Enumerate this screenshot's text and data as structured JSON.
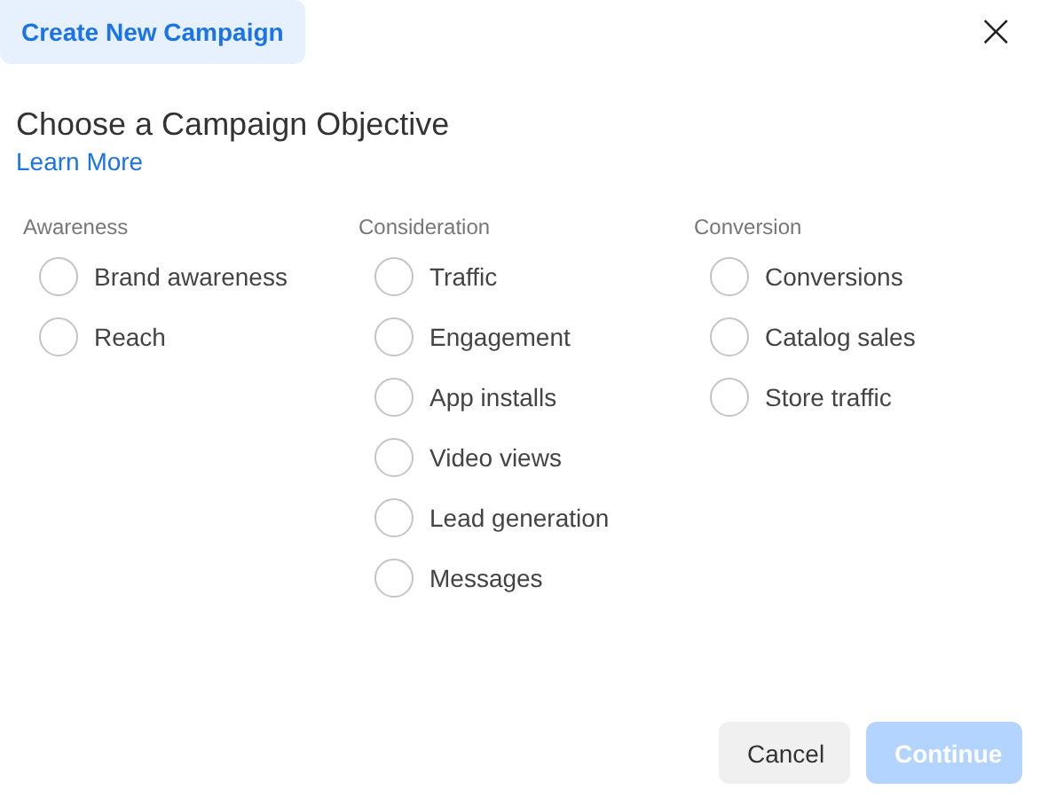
{
  "tab": {
    "label": "Create New Campaign",
    "selected": true
  },
  "close": {
    "label": "×"
  },
  "heading": "Choose a Campaign Objective",
  "learn_more": "Learn More",
  "groups": [
    {
      "label": "Awareness",
      "options": [
        {
          "label": "Brand awareness",
          "selected": false
        },
        {
          "label": "Reach",
          "selected": false
        }
      ]
    },
    {
      "label": "Consideration",
      "options": [
        {
          "label": "Traffic",
          "selected": false
        },
        {
          "label": "Engagement",
          "selected": false
        },
        {
          "label": "App installs",
          "selected": false
        },
        {
          "label": "Video views",
          "selected": false
        },
        {
          "label": "Lead generation",
          "selected": false
        },
        {
          "label": "Messages",
          "selected": false
        }
      ]
    },
    {
      "label": "Conversion",
      "options": [
        {
          "label": "Conversions",
          "selected": false
        },
        {
          "label": "Catalog sales",
          "selected": false
        },
        {
          "label": "Store traffic",
          "selected": false
        }
      ]
    }
  ],
  "buttons": [
    {
      "label": "Cancel",
      "kind": "secondary",
      "disabled": false
    },
    {
      "label": "Continue",
      "kind": "primary",
      "disabled": true
    }
  ]
}
